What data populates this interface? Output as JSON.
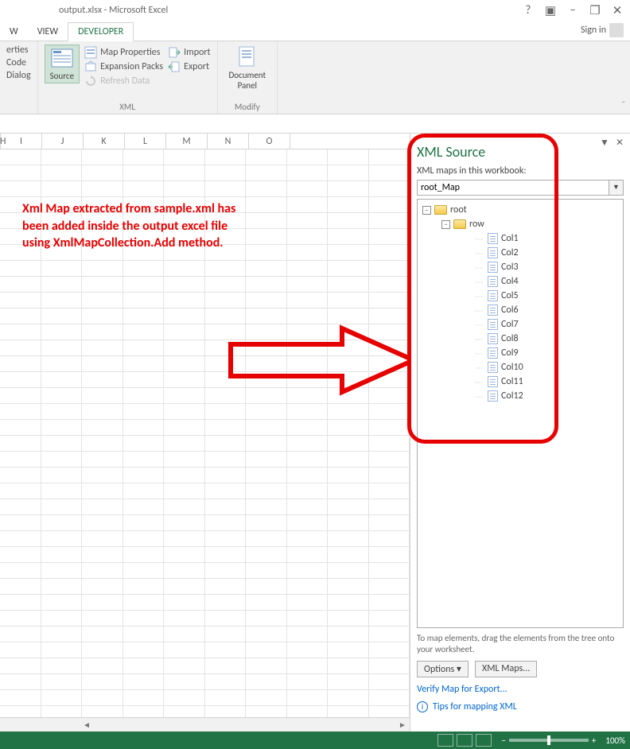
{
  "title": "output.xlsx - Microsoft Excel",
  "signin": "Sign in",
  "tabs": {
    "a": "W",
    "b": "VIEW",
    "c": "DEVELOPER"
  },
  "ribbon": {
    "g1": {
      "a": "erties",
      "b": "Code",
      "c": "Dialog"
    },
    "source": "Source",
    "g2": {
      "a": "Map Properties",
      "b": "Expansion Packs",
      "c": "Refresh Data",
      "imp": "Import",
      "exp": "Export",
      "label": "XML"
    },
    "g3": {
      "a": "Document",
      "b": "Panel",
      "label": "Modify"
    }
  },
  "cols": [
    "H",
    "I",
    "J",
    "K",
    "L",
    "M",
    "N",
    "O"
  ],
  "annotation": {
    "l1": "Xml Map extracted from sample.xml has",
    "l2": "been added inside the output excel file",
    "l3": "using XmlMapCollection.Add method."
  },
  "pane": {
    "title": "XML Source",
    "mapsLabel": "XML maps in this workbook:",
    "mapName": "root_Map",
    "root": "root",
    "row": "row",
    "cols": [
      "Col1",
      "Col2",
      "Col3",
      "Col4",
      "Col5",
      "Col6",
      "Col7",
      "Col8",
      "Col9",
      "Col10",
      "Col11",
      "Col12"
    ],
    "hint": "To map elements, drag the elements from the tree onto your worksheet.",
    "options": "Options",
    "xmlmaps": "XML Maps...",
    "verify": "Verify Map for Export...",
    "tips": "Tips for mapping XML"
  },
  "status": {
    "zoom": "100%"
  }
}
